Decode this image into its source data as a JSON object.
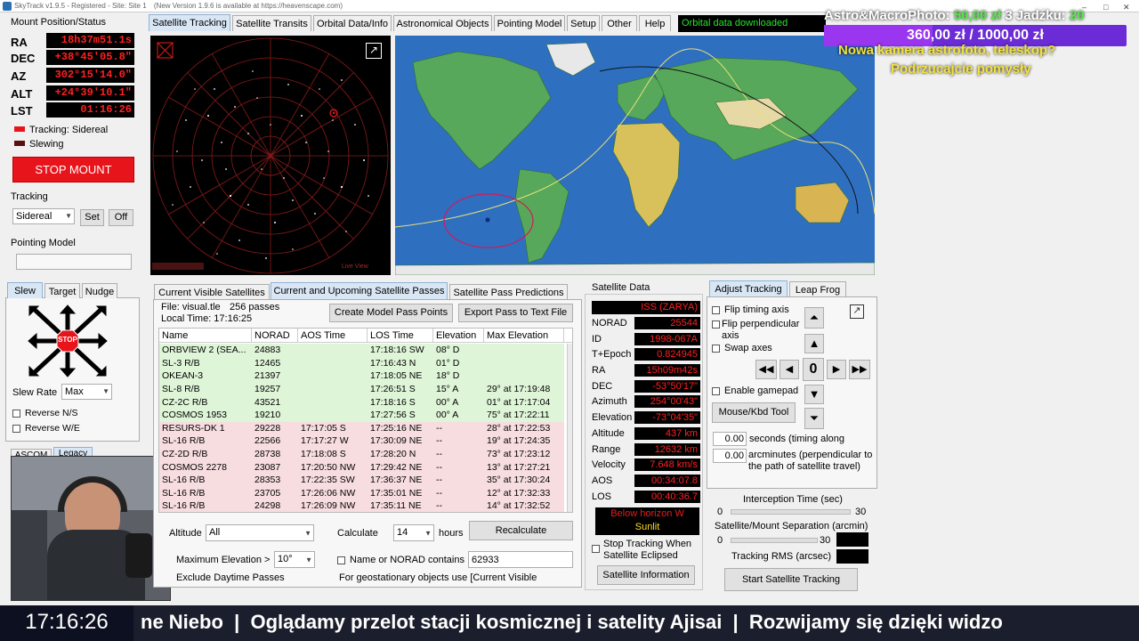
{
  "window": {
    "title": "SkyTrack v1.9.5 - Registered - Site: Site 1",
    "version_note": "(New Version 1.9.6 is available at https://heavenscape.com)"
  },
  "mount": {
    "section_title": "Mount Position/Status",
    "ra_label": "RA",
    "ra": "18h37m51.1s",
    "dec_label": "DEC",
    "dec": "+38°45'05.8\"",
    "az_label": "AZ",
    "az": "302°15'14.0\"",
    "alt_label": "ALT",
    "alt": "+24°39'10.1\"",
    "lst_label": "LST",
    "lst": "01:16:26",
    "tracking_status": "Tracking: Sidereal",
    "slewing_status": "Slewing",
    "stop_button": "STOP MOUNT",
    "tracking_title": "Tracking",
    "tracking_rate": "Sidereal",
    "set_button": "Set",
    "off_button": "Off",
    "pointing_model_title": "Pointing Model",
    "pointing_model_value": "",
    "colors": {
      "tracking": "#e8141b",
      "slewing": "#5a1010"
    }
  },
  "slew_panel": {
    "tabs": [
      "Slew",
      "Target",
      "Nudge"
    ],
    "stop_label": "STOP",
    "slew_rate_label": "Slew Rate",
    "slew_rate": "Max",
    "reverse_ns": "Reverse N/S",
    "reverse_we": "Reverse W/E",
    "ascom_tab": "ASCOM",
    "legacy_tab": "Legacy"
  },
  "main_tabs": [
    "Satellite Tracking",
    "Satellite Transits",
    "Orbital Data/Info",
    "Astronomical Objects",
    "Pointing Model",
    "Setup",
    "Other",
    "Help"
  ],
  "status_message": "Orbital data downloaded",
  "overlay": {
    "line1_prefix": "Astro&MacroPhoto:",
    "line1_amount": "50,00 zł",
    "line1_suffix": "3 Jadźku:",
    "line1_end": "20",
    "goal": "360,00 zł / 1000,00 zł",
    "line2": "Nowa kamera astrofoto, teleskop?",
    "line3": "Podrzucajcie pomysły"
  },
  "sky_view": {
    "label": "Live View",
    "popout_icon": "popout-icon"
  },
  "passes_tabs": [
    "Current Visible Satellites",
    "Current and Upcoming Satellite Passes",
    "Satellite Pass Predictions"
  ],
  "passes": {
    "file": "File: visual.tle",
    "count": "256 passes",
    "local_time": "Local Time: 17:16:25",
    "create_button": "Create Model Pass Points",
    "export_button": "Export Pass to Text File",
    "columns": [
      "Name",
      "NORAD",
      "AOS Time",
      "LOS Time",
      "Elevation",
      "Max Elevation"
    ],
    "rows": [
      {
        "name": "ORBVIEW 2 (SEA...",
        "norad": "24883",
        "aos": "",
        "los": "17:18:16 SW",
        "elev": "08° D",
        "max": "",
        "state": "vis"
      },
      {
        "name": "SL-3 R/B",
        "norad": "12465",
        "aos": "",
        "los": "17:16:43 N",
        "elev": "01° D",
        "max": "",
        "state": "vis"
      },
      {
        "name": "OKEAN-3",
        "norad": "21397",
        "aos": "",
        "los": "17:18:05 NE",
        "elev": "18° D",
        "max": "",
        "state": "vis"
      },
      {
        "name": "SL-8 R/B",
        "norad": "19257",
        "aos": "",
        "los": "17:26:51 S",
        "elev": "15° A",
        "max": "29° at 17:19:48",
        "state": "vis"
      },
      {
        "name": "CZ-2C R/B",
        "norad": "43521",
        "aos": "",
        "los": "17:18:16 S",
        "elev": "00° A",
        "max": "01° at 17:17:04",
        "state": "vis"
      },
      {
        "name": "COSMOS 1953",
        "norad": "19210",
        "aos": "",
        "los": "17:27:56 S",
        "elev": "00° A",
        "max": "75° at 17:22:11",
        "state": "vis"
      },
      {
        "name": "RESURS-DK 1",
        "norad": "29228",
        "aos": "17:17:05 S",
        "los": "17:25:16 NE",
        "elev": "--",
        "max": "28° at 17:22:53",
        "state": "up"
      },
      {
        "name": "SL-16 R/B",
        "norad": "22566",
        "aos": "17:17:27 W",
        "los": "17:30:09 NE",
        "elev": "--",
        "max": "19° at 17:24:35",
        "state": "up"
      },
      {
        "name": "CZ-2D R/B",
        "norad": "28738",
        "aos": "17:18:08 S",
        "los": "17:28:20 N",
        "elev": "--",
        "max": "73° at 17:23:12",
        "state": "up"
      },
      {
        "name": "COSMOS 2278",
        "norad": "23087",
        "aos": "17:20:50 NW",
        "los": "17:29:42 NE",
        "elev": "--",
        "max": "13° at 17:27:21",
        "state": "up"
      },
      {
        "name": "SL-16 R/B",
        "norad": "28353",
        "aos": "17:22:35 SW",
        "los": "17:36:37 NE",
        "elev": "--",
        "max": "35° at 17:30:24",
        "state": "up"
      },
      {
        "name": "SL-16 R/B",
        "norad": "23705",
        "aos": "17:26:06 NW",
        "los": "17:35:01 NE",
        "elev": "--",
        "max": "12° at 17:32:33",
        "state": "up"
      },
      {
        "name": "SL-16 R/B",
        "norad": "24298",
        "aos": "17:26:09 NW",
        "los": "17:35:11 NE",
        "elev": "--",
        "max": "14° at 17:32:52",
        "state": "up"
      }
    ],
    "altitude_label": "Altitude",
    "altitude_value": "All",
    "calculate_label": "Calculate",
    "calculate_value": "14",
    "hours_label": "hours",
    "recalc_button": "Recalculate",
    "max_elev_label": "Maximum Elevation >",
    "max_elev_value": "10°",
    "name_norad_label": "Name or NORAD contains",
    "name_norad_value": "62933",
    "exclude_label": "Exclude Daytime Passes",
    "geo_note": "For geostationary objects use [Current Visible"
  },
  "satellite_data": {
    "title": "Satellite Data",
    "name": "ISS (ZARYA)",
    "fields": [
      {
        "label": "NORAD",
        "value": "25544"
      },
      {
        "label": "ID",
        "value": "1998-067A"
      },
      {
        "label": "T+Epoch",
        "value": "0.824945"
      },
      {
        "label": "RA",
        "value": "15h09m42s"
      },
      {
        "label": "DEC",
        "value": "-53°50'17\""
      },
      {
        "label": "Azimuth",
        "value": "254°00'43\""
      },
      {
        "label": "Elevation",
        "value": "-73°04'35\""
      },
      {
        "label": "Altitude",
        "value": "437 km"
      },
      {
        "label": "Range",
        "value": "12632 km"
      },
      {
        "label": "Velocity",
        "value": "7.648 km/s"
      },
      {
        "label": "AOS",
        "value": "00:34:07.8"
      },
      {
        "label": "LOS",
        "value": "00:40:36.7"
      }
    ],
    "horizon_status": "Below horizon W",
    "sunlit": "Sunlit",
    "stop_eclipsed": "Stop Tracking When Satellite Eclipsed",
    "info_button": "Satellite Information"
  },
  "adjust": {
    "tabs": [
      "Adjust Tracking",
      "Leap Frog"
    ],
    "flip_timing": "Flip timing axis",
    "flip_perp": "Flip perpendicular axis",
    "swap_axes": "Swap axes",
    "enable_gamepad": "Enable gamepad",
    "mouse_tool": "Mouse/Kbd Tool",
    "center_value": "0",
    "timing_value": "0.00",
    "timing_label": "seconds (timing along",
    "perp_value": "0.00",
    "perp_label": "arcminutes (perpendicular to the path of satellite travel)",
    "interception_title": "Interception Time (sec)",
    "interception_min": "0",
    "interception_max": "30",
    "separation_title": "Satellite/Mount Separation (arcmin)",
    "separation_min": "0",
    "separation_max": "30",
    "rms_label": "Tracking RMS (arcsec)",
    "start_button": "Start Satellite Tracking"
  },
  "ticker": {
    "clock": "17:16:26",
    "text": "ne Niebo  |  Oglądamy przelot stacji kosmicznej i satelity Ajisai  |  Rozwijamy się dzięki widzo"
  }
}
